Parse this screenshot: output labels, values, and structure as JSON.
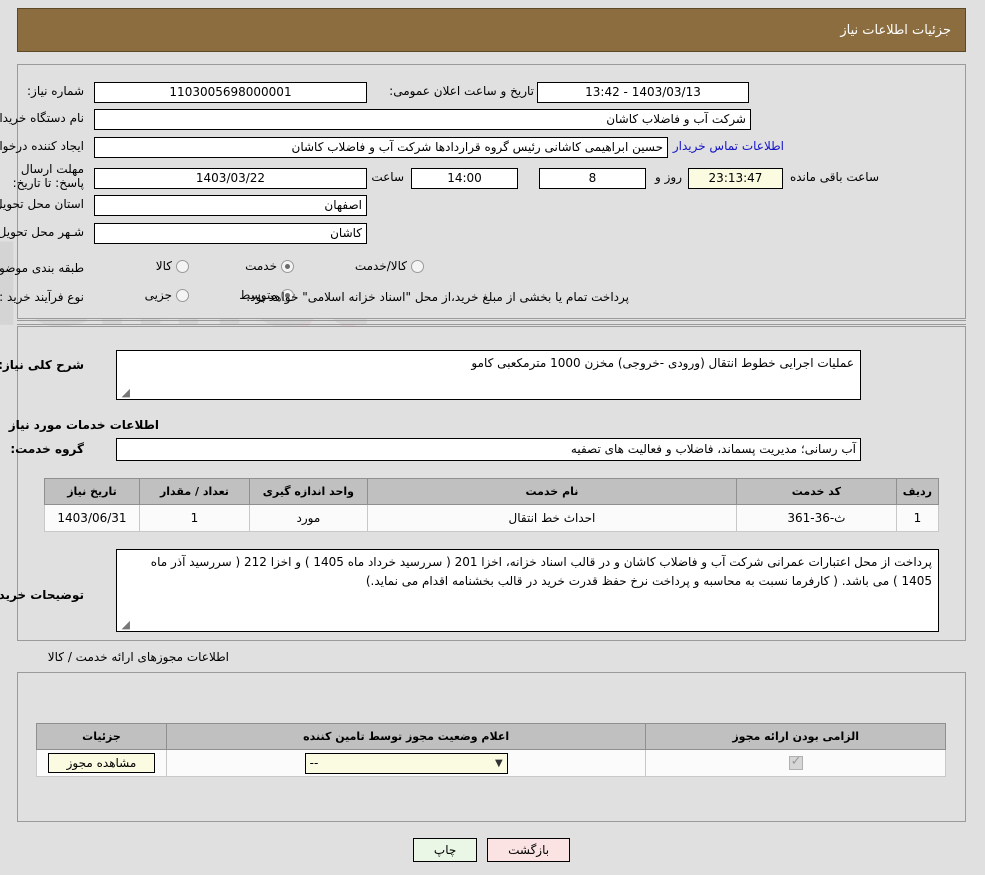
{
  "header": {
    "title": "جزئیات اطلاعات نیاز"
  },
  "main": {
    "need_number_label": "شماره نیاز:",
    "need_number_value": "1103005698000001",
    "announce_label": "تاریخ و ساعت اعلان عمومی:",
    "announce_value": "1403/03/13 - 13:42",
    "buyer_org_label": "نام دستگاه خریدار:",
    "buyer_org_value": "شرکت آب و فاضلاب کاشان",
    "creator_label": "ایجاد کننده درخواست:",
    "creator_value": "حسین ابراهیمی کاشانی رئیس گروه قراردادها شرکت آب و فاضلاب کاشان",
    "contact_link": "اطلاعات تماس خریدار",
    "deadline_label": "مهلت ارسال پاسخ: تا تاریخ:",
    "deadline_date": "1403/03/22",
    "deadline_hour_label": "ساعت",
    "deadline_hour": "14:00",
    "remaining_days": "8",
    "remaining_days_label": "روز و",
    "remaining_time": "23:13:47",
    "remaining_time_label": "ساعت باقی مانده",
    "province_label": "استان محل تحویل:",
    "province_value": "اصفهان",
    "city_label": "شـهر محل تحویل:",
    "city_value": "کاشان",
    "category_label": "طبقه بندی موضوعی:",
    "category_options": [
      {
        "label": "کالا",
        "selected": false
      },
      {
        "label": "خدمت",
        "selected": true
      },
      {
        "label": "کالا/خدمت",
        "selected": false
      }
    ],
    "process_label": "نوع فرآیند خرید :",
    "process_options": [
      {
        "label": "جزیی",
        "selected": false
      },
      {
        "label": "متوسط",
        "selected": true
      }
    ],
    "payment_note": "پرداخت تمام یا بخشی از مبلغ خرید،از محل \"اسناد خزانه اسلامی\" خواهد بود."
  },
  "description": {
    "general_label": "شرح کلی نیاز:",
    "general_value": "عملیات اجرایی خطوط انتقال (ورودی -خروجی) مخزن 1000 مترمکعبی کامو",
    "services_section_title": "اطلاعات خدمات مورد نیاز",
    "service_group_label": "گروه خدمت:",
    "service_group_value": "آب رسانی؛ مدیریت پسماند، فاضلاب و فعالیت های تصفیه"
  },
  "services_table": {
    "columns": [
      "ردیف",
      "کد خدمت",
      "نام خدمت",
      "واحد اندازه گیری",
      "تعداد / مقدار",
      "تاریخ نیاز"
    ],
    "rows": [
      {
        "row": "1",
        "code": "ث-36-361",
        "name": "احداث خط انتقال",
        "unit": "مورد",
        "quantity": "1",
        "date": "1403/06/31"
      }
    ]
  },
  "buyer_notes": {
    "label": "توضیحات خریدار:",
    "value": "پرداخت از محل اعتبارات عمرانی شرکت آب و فاضلاب کاشان و در قالب اسناد خزانه،  اخزا  201 ( سررسید خرداد ماه 1405 ) و اخزا 212 ( سررسید آذر ماه 1405 ) می باشد. ( کارفرما نسبت به محاسبه و پرداخت نرخ حفظ قدرت خرید در قالب بخشنامه اقدام می نماید.)"
  },
  "permits": {
    "section_title": "اطلاعات مجوزهای ارائه خدمت / کالا",
    "columns": [
      "الزامی بودن ارائه مجوز",
      "اعلام وضعیت مجوز توسط تامین کننده",
      "جزئیات"
    ],
    "rows": [
      {
        "required": true,
        "status_value": "--",
        "details_button": "مشاهده مجوز"
      }
    ]
  },
  "footer": {
    "print_label": "چاپ",
    "back_label": "بازگشت"
  },
  "watermark": {
    "text": "AriaTender.net"
  },
  "colors": {
    "header_bar": "#8c6d3f",
    "page_bg": "#e0e0e0",
    "table_header": "#c0c0c0",
    "link": "#1414c8",
    "field_yellow": "#fbfbe2",
    "print_button": "#eaf6e6",
    "back_button": "#fbe3e3"
  }
}
